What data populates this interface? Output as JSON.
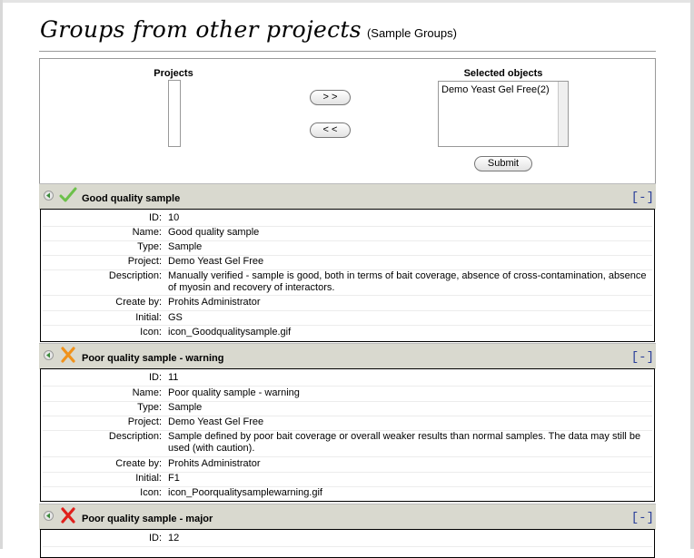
{
  "page": {
    "title": "Groups from other projects",
    "subtitle": "(Sample Groups)"
  },
  "selector": {
    "projects_label": "Projects",
    "selected_label": "Selected objects",
    "selected_items": [
      "Demo Yeast Gel Free(2)"
    ],
    "add_button": "> >",
    "remove_button": "< <",
    "submit_button": "Submit"
  },
  "field_labels": {
    "id": "ID:",
    "name": "Name:",
    "type": "Type:",
    "project": "Project:",
    "description": "Description:",
    "created_by": "Create by:",
    "initial": "Initial:",
    "icon": "Icon:"
  },
  "groups": [
    {
      "status_icon": "check-icon",
      "status_color": "#6cc04a",
      "name": "Good quality sample",
      "collapse_label": "[-]",
      "id": "10",
      "type": "Sample",
      "project": "Demo Yeast Gel Free",
      "description": "Manually verified - sample is good, both in terms of bait coverage, absence of cross-contamination, absence of myosin and recovery of interactors.",
      "created_by": "Prohits Administrator",
      "initial": "GS",
      "icon": "icon_Goodqualitysample.gif"
    },
    {
      "status_icon": "cross-icon",
      "status_color": "#f0921c",
      "name": "Poor quality sample - warning",
      "collapse_label": "[-]",
      "id": "11",
      "type": "Sample",
      "project": "Demo Yeast Gel Free",
      "description": "Sample defined by poor bait coverage or overall weaker results than normal samples. The data may still be used (with caution).",
      "created_by": "Prohits Administrator",
      "initial": "F1",
      "icon": "icon_Poorqualitysamplewarning.gif"
    },
    {
      "status_icon": "cross-icon",
      "status_color": "#e0201c",
      "name": "Poor quality sample - major",
      "collapse_label": "[-]",
      "id": "12"
    }
  ]
}
